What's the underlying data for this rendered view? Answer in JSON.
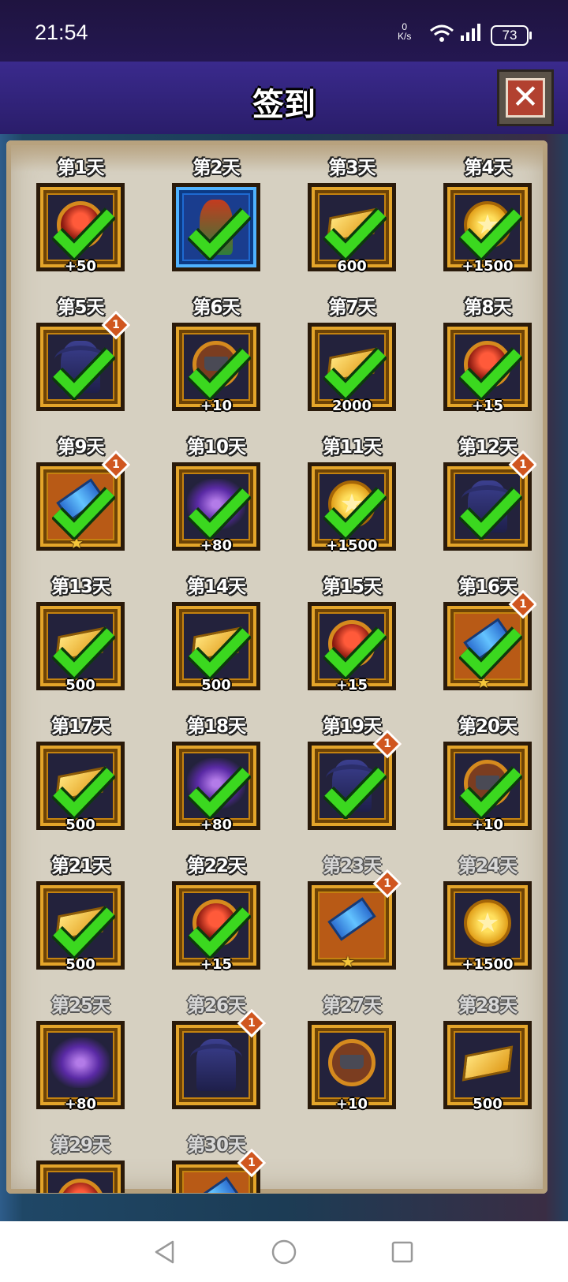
{
  "status_bar": {
    "time": "21:54",
    "net_speed_value": "0",
    "net_speed_unit": "K/s",
    "battery": "73"
  },
  "header": {
    "title": "签到"
  },
  "days": [
    {
      "label": "第1天",
      "item": "orb",
      "amount": "+50",
      "claimed": true
    },
    {
      "label": "第2天",
      "item": "staff",
      "amount": "",
      "claimed": true
    },
    {
      "label": "第3天",
      "item": "gold",
      "amount": "600",
      "claimed": true
    },
    {
      "label": "第4天",
      "item": "coin",
      "amount": "+1500",
      "claimed": true
    },
    {
      "label": "第5天",
      "item": "demon",
      "amount": "",
      "claimed": true,
      "badge": "1"
    },
    {
      "label": "第6天",
      "item": "anvil",
      "amount": "+10",
      "claimed": true
    },
    {
      "label": "第7天",
      "item": "gold",
      "amount": "2000",
      "claimed": true
    },
    {
      "label": "第8天",
      "item": "orb",
      "amount": "+15",
      "claimed": true
    },
    {
      "label": "第9天",
      "item": "gauntlet",
      "amount": "",
      "claimed": true,
      "badge": "1",
      "star": true
    },
    {
      "label": "第10天",
      "item": "galaxy",
      "amount": "+80",
      "claimed": true
    },
    {
      "label": "第11天",
      "item": "coin",
      "amount": "+1500",
      "claimed": true
    },
    {
      "label": "第12天",
      "item": "demon",
      "amount": "",
      "claimed": true,
      "badge": "1"
    },
    {
      "label": "第13天",
      "item": "gold",
      "amount": "500",
      "claimed": true
    },
    {
      "label": "第14天",
      "item": "gold",
      "amount": "500",
      "claimed": true
    },
    {
      "label": "第15天",
      "item": "orb",
      "amount": "+15",
      "claimed": true
    },
    {
      "label": "第16天",
      "item": "gauntlet",
      "amount": "",
      "claimed": true,
      "badge": "1",
      "star": true
    },
    {
      "label": "第17天",
      "item": "gold",
      "amount": "500",
      "claimed": true
    },
    {
      "label": "第18天",
      "item": "galaxy",
      "amount": "+80",
      "claimed": true
    },
    {
      "label": "第19天",
      "item": "demon",
      "amount": "",
      "claimed": true,
      "badge": "1"
    },
    {
      "label": "第20天",
      "item": "anvil",
      "amount": "+10",
      "claimed": true
    },
    {
      "label": "第21天",
      "item": "gold",
      "amount": "500",
      "claimed": true
    },
    {
      "label": "第22天",
      "item": "orb",
      "amount": "+15",
      "claimed": true
    },
    {
      "label": "第23天",
      "item": "gauntlet",
      "amount": "",
      "claimed": false,
      "badge": "1",
      "star": true
    },
    {
      "label": "第24天",
      "item": "coin",
      "amount": "+1500",
      "claimed": false
    },
    {
      "label": "第25天",
      "item": "galaxy",
      "amount": "+80",
      "claimed": false
    },
    {
      "label": "第26天",
      "item": "demon",
      "amount": "",
      "claimed": false,
      "badge": "1"
    },
    {
      "label": "第27天",
      "item": "anvil",
      "amount": "+10",
      "claimed": false
    },
    {
      "label": "第28天",
      "item": "gold",
      "amount": "500",
      "claimed": false
    },
    {
      "label": "第29天",
      "item": "orb",
      "amount": "",
      "claimed": false
    },
    {
      "label": "第30天",
      "item": "gauntlet",
      "amount": "",
      "claimed": false,
      "badge": "1"
    }
  ]
}
